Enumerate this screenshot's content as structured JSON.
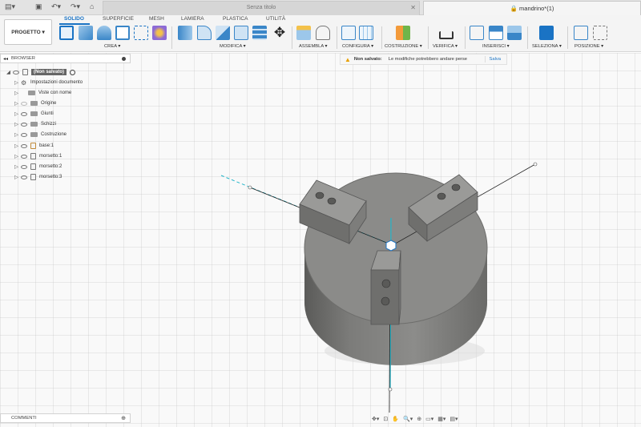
{
  "topbar": {
    "tab_left_title": "Senza titolo",
    "tab_right_title": "mandrino*(1)"
  },
  "ribbon": {
    "project_label": "PROGETTO ▾",
    "tabs": [
      "SOLIDO",
      "SUPERFICIE",
      "MESH",
      "LAMIERA",
      "PLASTICA",
      "UTILITÀ"
    ],
    "groups": [
      "CREA ▾",
      "MODIFICA ▾",
      "ASSEMBLA ▾",
      "CONFIGURA ▾",
      "COSTRUZIONE ▾",
      "VERIFICA ▾",
      "INSERISCI ▾",
      "SELEZIONA ▾",
      "POSIZIONE ▾"
    ]
  },
  "browser": {
    "title": "BROWSER",
    "root_label": "(Non salvato)",
    "items": [
      {
        "label": "Impostazioni documento",
        "type": "gear"
      },
      {
        "label": "Viste con nome",
        "type": "folder"
      },
      {
        "label": "Origine",
        "type": "folder",
        "eye_off": true
      },
      {
        "label": "Giunti",
        "type": "folder"
      },
      {
        "label": "Schizzi",
        "type": "folder"
      },
      {
        "label": "Costruzione",
        "type": "folder"
      },
      {
        "label": "base:1",
        "type": "comp"
      },
      {
        "label": "morsetto:1",
        "type": "comp"
      },
      {
        "label": "morsetto:2",
        "type": "comp"
      },
      {
        "label": "morsetto:3",
        "type": "comp"
      }
    ]
  },
  "warning": {
    "title": "Non salvato:",
    "message": "Le modifiche potrebbero andare perse",
    "save_label": "Salva"
  },
  "comments": {
    "label": "COMMENTI"
  },
  "colors": {
    "accent": "#1a73c4",
    "body": "#7f7f7d",
    "jaw": "#8a8a88"
  }
}
